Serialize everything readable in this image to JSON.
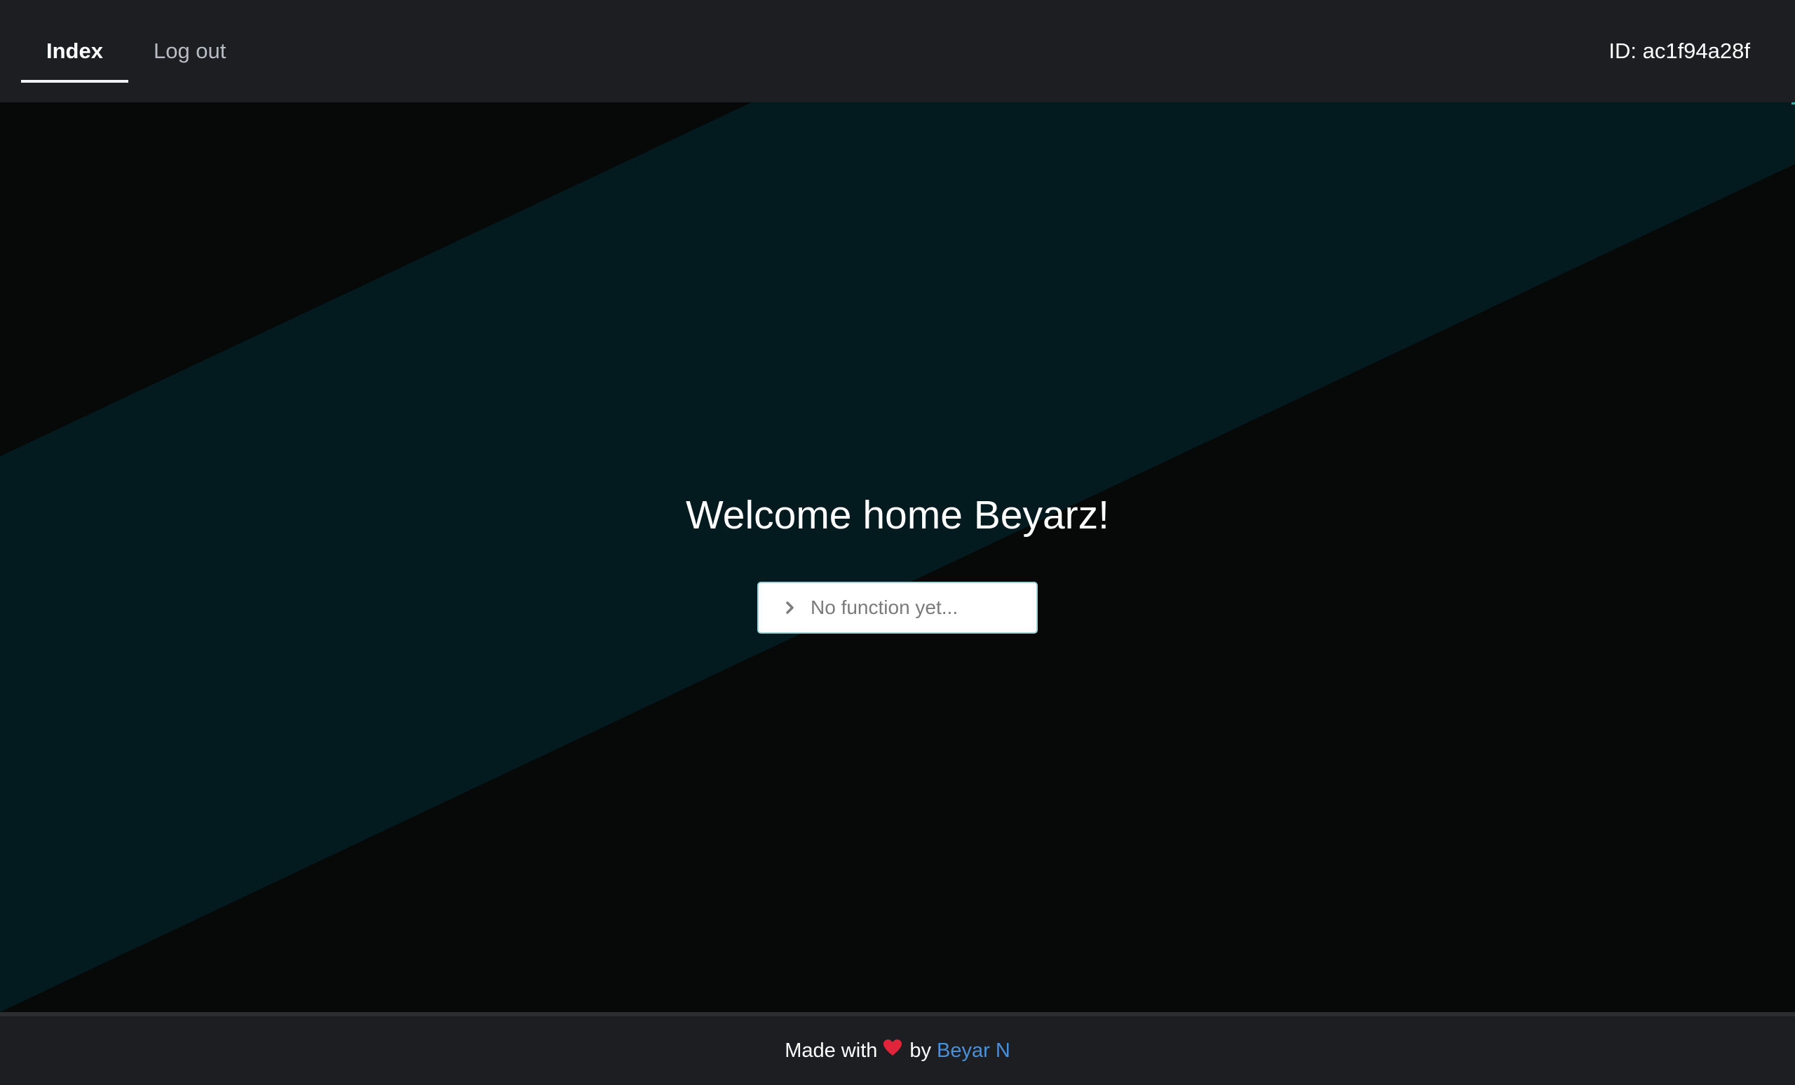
{
  "nav": {
    "tabs": [
      {
        "label": "Index",
        "active": true
      },
      {
        "label": "Log out",
        "active": false
      }
    ],
    "user_id": "ID: ac1f94a28f"
  },
  "hero": {
    "title": "Welcome home Beyarz!",
    "input_placeholder": "No function yet...",
    "input_icon": "chevron-right-icon"
  },
  "footer": {
    "made_with": "Made with",
    "heart_icon": "heart-icon",
    "by": "by",
    "author": "Beyar N"
  },
  "colors": {
    "topbar": "#1c1e22",
    "hero_dark": "#070808",
    "hero_band": "#031a1f",
    "link": "#4a90d9",
    "heart": "#e0243a"
  }
}
